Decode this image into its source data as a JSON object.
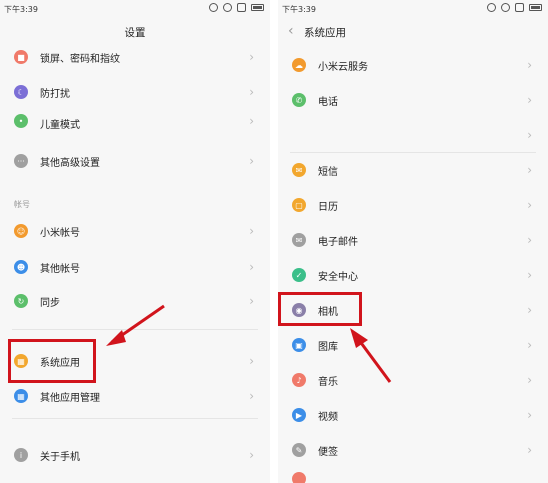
{
  "status_time": "下午3:39",
  "left_panel": {
    "title": "设置",
    "section_account": "帐号",
    "items": [
      {
        "label": "锁屏、密码和指纹",
        "icon": "lock-icon",
        "color": "#f07a6a"
      },
      {
        "label": "防打扰",
        "icon": "moon-icon",
        "color": "#7c6fd6"
      },
      {
        "label": "儿童模式",
        "icon": "child-mode-icon",
        "color": "#5cbf6b"
      },
      {
        "label": "其他高级设置",
        "icon": "more-dots-icon",
        "color": "#a0a0a0"
      },
      {
        "label": "小米帐号",
        "icon": "mi-account-icon",
        "color": "#f29a2e"
      },
      {
        "label": "其他帐号",
        "icon": "user-icon",
        "color": "#3c8ee8"
      },
      {
        "label": "同步",
        "icon": "sync-icon",
        "color": "#5cbf6b"
      },
      {
        "label": "系统应用",
        "icon": "system-apps-icon",
        "color": "#f2a72e"
      },
      {
        "label": "其他应用管理",
        "icon": "app-manage-icon",
        "color": "#3c8ee8"
      },
      {
        "label": "关于手机",
        "icon": "info-icon",
        "color": "#a0a0a0"
      }
    ]
  },
  "right_panel": {
    "title": "系统应用",
    "items": [
      {
        "label": "小米云服务",
        "icon": "cloud-icon",
        "color": "#f29a2e"
      },
      {
        "label": "电话",
        "icon": "phone-icon",
        "color": "#5cbf6b"
      },
      {
        "label": "",
        "icon": "",
        "color": ""
      },
      {
        "label": "短信",
        "icon": "sms-icon",
        "color": "#f2a72e"
      },
      {
        "label": "日历",
        "icon": "calendar-icon",
        "color": "#f2a72e"
      },
      {
        "label": "电子邮件",
        "icon": "mail-icon",
        "color": "#a0a0a0"
      },
      {
        "label": "安全中心",
        "icon": "shield-icon",
        "color": "#3bbf8a"
      },
      {
        "label": "相机",
        "icon": "camera-icon",
        "color": "#8a7fa8"
      },
      {
        "label": "图库",
        "icon": "gallery-icon",
        "color": "#3c8ee8"
      },
      {
        "label": "音乐",
        "icon": "music-icon",
        "color": "#f07a6a"
      },
      {
        "label": "视频",
        "icon": "video-icon",
        "color": "#3c8ee8"
      },
      {
        "label": "便签",
        "icon": "notes-icon",
        "color": "#a0a0a0"
      },
      {
        "label": "",
        "icon": "recorder-icon",
        "color": "#f07a6a"
      }
    ]
  },
  "highlight_color": "#d1141c"
}
